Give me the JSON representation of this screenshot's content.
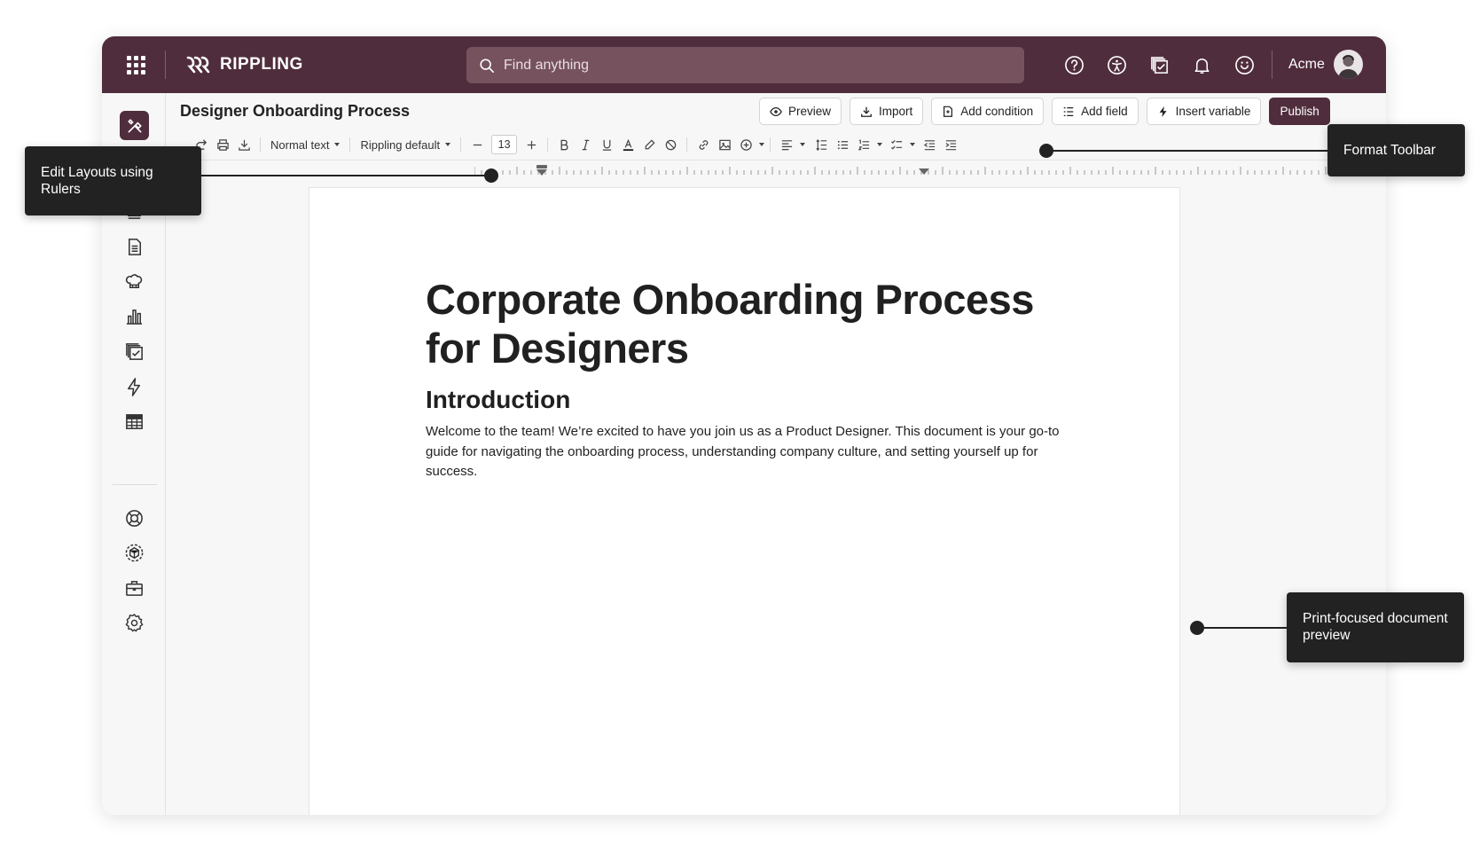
{
  "topbar": {
    "brand": "RIPPLING",
    "search_placeholder": "Find anything",
    "account_name": "Acme",
    "icons": [
      "help-icon",
      "accessibility-icon",
      "approvals-icon",
      "notifications-icon",
      "support-icon"
    ]
  },
  "sidebar": {
    "items": [
      "tools-icon",
      "stamp-icon",
      "document-icon",
      "chef-hat-icon",
      "bar-chart-icon",
      "tasks-icon",
      "lightning-icon",
      "table-icon",
      "lifebuoy-icon",
      "app-cube-icon",
      "briefcase-icon",
      "settings-icon"
    ]
  },
  "header": {
    "title": "Designer Onboarding Process",
    "preview_label": "Preview",
    "import_label": "Import",
    "add_condition_label": "Add condition",
    "add_field_label": "Add field",
    "insert_variable_label": "Insert variable",
    "publish_label": "Publish"
  },
  "toolbar": {
    "text_style": "Normal text",
    "font_family": "Rippling default",
    "font_size": "13"
  },
  "document": {
    "title": "Corporate Onboarding Process for Designers",
    "heading": "Introduction",
    "body": "Welcome to the team! We’re excited to have you join us as a Product Designer. This document is your go-to guide for navigating the onboarding process, understanding company culture, and setting yourself up for success."
  },
  "callouts": {
    "rulers": "Edit Layouts using Rulers",
    "toolbar": "Format Toolbar",
    "preview": "Print-focused document preview"
  },
  "colors": {
    "brand": "#502d3c",
    "search_bg": "#76525f",
    "callout_bg": "#222222"
  }
}
